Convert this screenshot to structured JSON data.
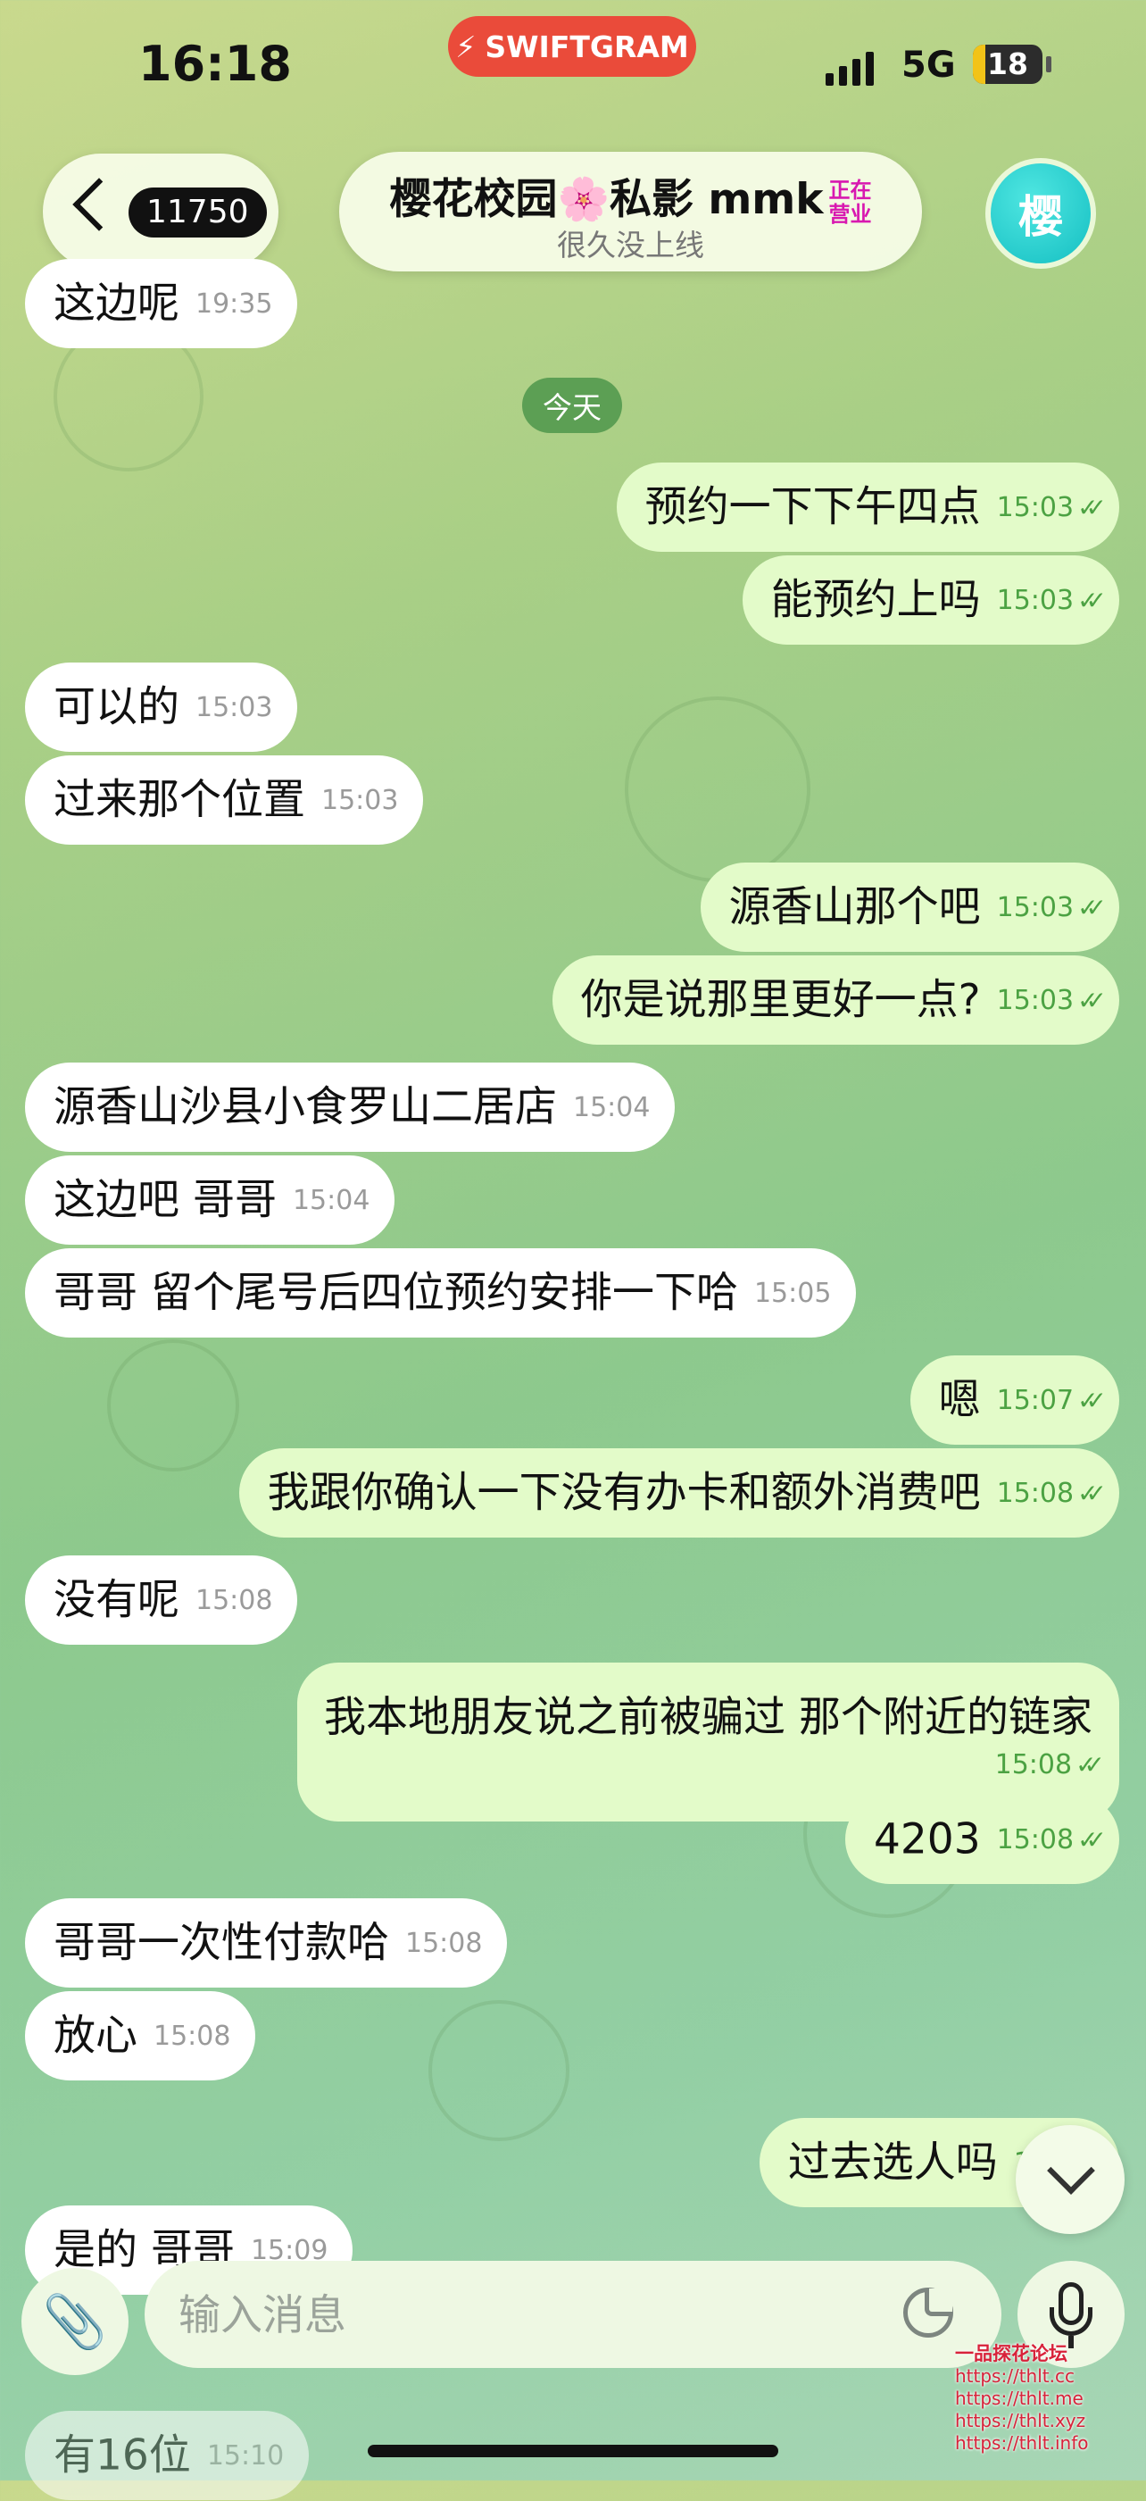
{
  "status_bar": {
    "time": "16:18",
    "badge": "SWIFTGRAM",
    "network": "5G",
    "battery": "18",
    "battery_fraction": 0.18
  },
  "header": {
    "back_count": "11750",
    "title": "樱花校园🌸私影 mmk",
    "title_stamp": "正在营业",
    "subtitle": "很久没上线",
    "avatar_letter": "樱"
  },
  "chat": {
    "top_message": {
      "text": "这边呢",
      "time": "19:35"
    },
    "date_chip": "今天",
    "messages": [
      {
        "dir": "out",
        "text": "预约一下下午四点",
        "time": "15:03"
      },
      {
        "dir": "out",
        "text": "能预约上吗",
        "time": "15:03"
      },
      {
        "dir": "in",
        "text": "可以的",
        "time": "15:03"
      },
      {
        "dir": "in",
        "text": "过来那个位置",
        "time": "15:03"
      },
      {
        "dir": "out",
        "text": "源香山那个吧",
        "time": "15:03"
      },
      {
        "dir": "out",
        "text": "你是说那里更好一点?",
        "time": "15:03"
      },
      {
        "dir": "in",
        "text": "源香山沙县小食罗山二居店",
        "time": "15:04"
      },
      {
        "dir": "in",
        "text": "这边吧 哥哥",
        "time": "15:04"
      },
      {
        "dir": "in",
        "text": "哥哥 留个尾号后四位预约安排一下哈",
        "time": "15:05"
      },
      {
        "dir": "out",
        "text": "嗯",
        "time": "15:07"
      },
      {
        "dir": "out",
        "text": "我跟你确认一下没有办卡和额外消费吧",
        "time": "15:08"
      },
      {
        "dir": "in",
        "text": "没有呢",
        "time": "15:08"
      },
      {
        "dir": "out",
        "text": "我本地朋友说之前被骗过 那个附近的链家",
        "time": "15:08"
      },
      {
        "dir": "out",
        "text": "4203",
        "time": "15:08"
      },
      {
        "dir": "in",
        "text": "哥哥一次性付款哈",
        "time": "15:08"
      },
      {
        "dir": "in",
        "text": "放心",
        "time": "15:08"
      },
      {
        "dir": "out",
        "text": "过去选人吗",
        "time": "15:0"
      },
      {
        "dir": "in",
        "text": "是的 哥哥",
        "time": "15:09"
      },
      {
        "dir": "in",
        "text": "有16位",
        "time": "15:10"
      }
    ]
  },
  "composer": {
    "placeholder": "输入消息"
  },
  "icons": {
    "attach": "paperclip-icon",
    "sticker": "sticker-icon",
    "mic": "microphone-icon",
    "scroll": "chevron-down-icon",
    "back": "chevron-left-icon"
  },
  "watermark": {
    "title": "一品探花论坛",
    "lines": [
      "https://thlt.cc",
      "https://thlt.me",
      "https://thlt.xyz",
      "https://thlt.info"
    ]
  },
  "colors": {
    "outgoing_bubble": "#e3fbc9",
    "incoming_bubble": "#ffffff",
    "swiftgram_badge": "#ea4b3a",
    "date_chip": "#5c9f54",
    "read_ticks": "#4ca243"
  }
}
